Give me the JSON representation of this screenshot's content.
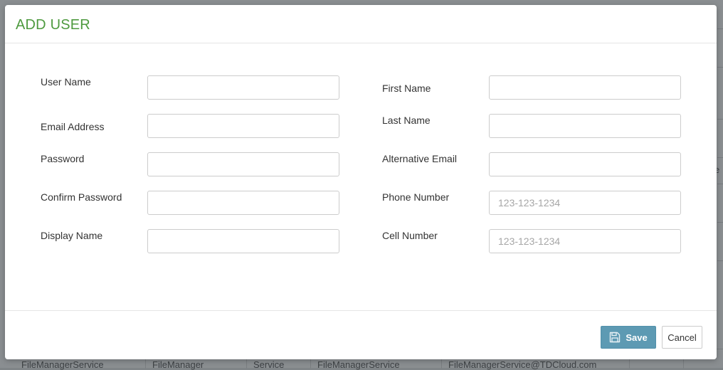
{
  "dialog": {
    "title": "ADD USER",
    "left_fields": [
      {
        "label": "User Name",
        "value": "",
        "placeholder": ""
      },
      {
        "label": "Email Address",
        "value": "",
        "placeholder": ""
      },
      {
        "label": "Password",
        "value": "",
        "placeholder": ""
      },
      {
        "label": "Confirm Password",
        "value": "",
        "placeholder": ""
      },
      {
        "label": "Display Name",
        "value": "",
        "placeholder": ""
      }
    ],
    "right_fields": [
      {
        "label": "First Name",
        "value": "",
        "placeholder": ""
      },
      {
        "label": "Last Name",
        "value": "",
        "placeholder": ""
      },
      {
        "label": "Alternative Email",
        "value": "",
        "placeholder": ""
      },
      {
        "label": "Phone Number",
        "value": "",
        "placeholder": "123-123-1234"
      },
      {
        "label": "Cell Number",
        "value": "",
        "placeholder": "123-123-1234"
      }
    ],
    "footer": {
      "save_label": "Save",
      "save_icon": "floppy-disk-icon",
      "cancel_label": "Cancel"
    },
    "colors": {
      "title": "#4e9a3f",
      "save_button": "#5d9ab3"
    }
  },
  "background_table": {
    "visible_row": [
      "FileManagerService",
      "FileManager",
      "Service",
      "FileManagerService",
      "FileManagerService@TDCloud.com"
    ],
    "edge_text": "e"
  }
}
